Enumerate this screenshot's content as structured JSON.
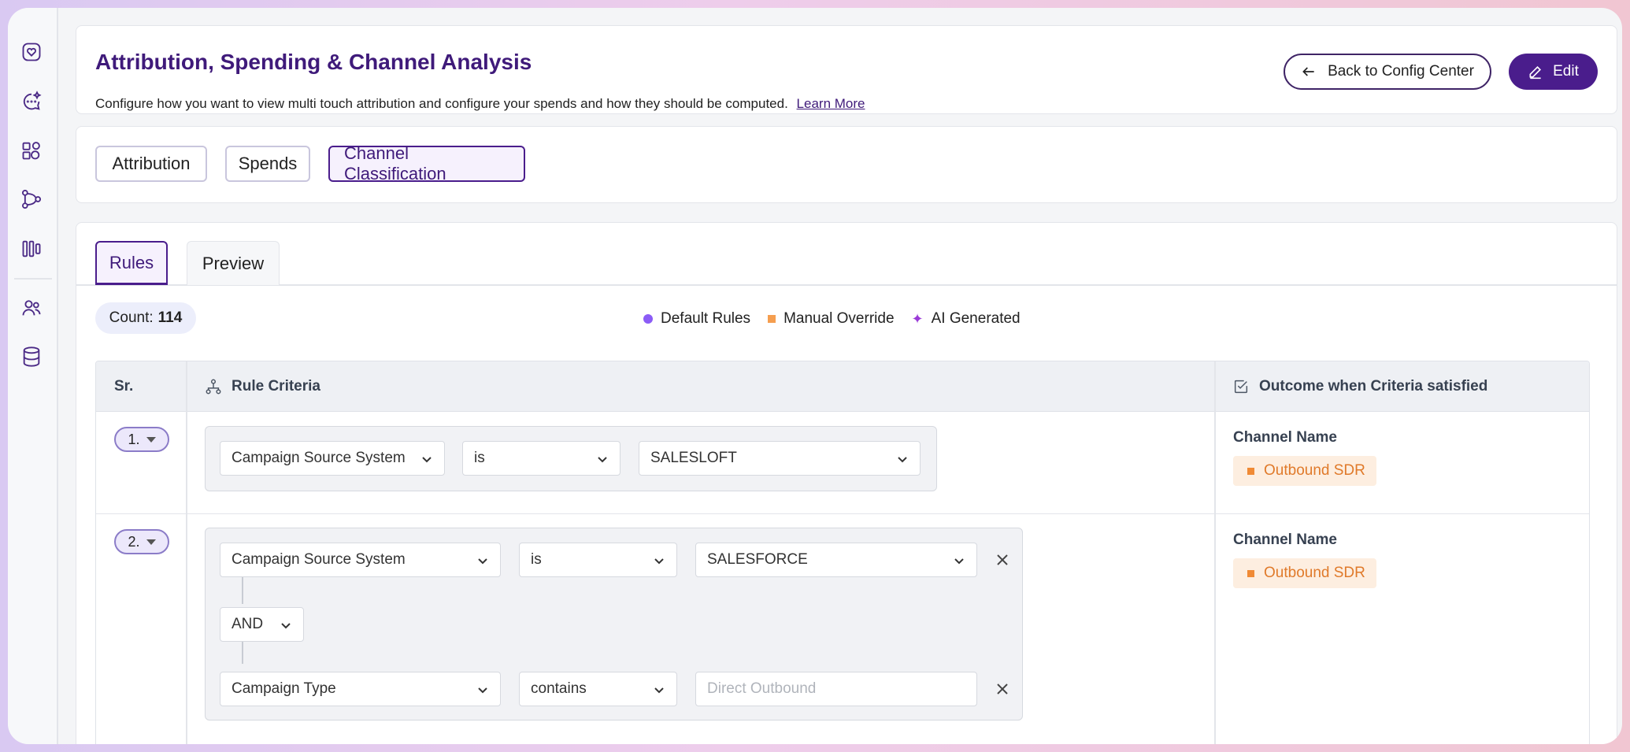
{
  "header": {
    "title": "Attribution, Spending & Channel Analysis",
    "subtitle": "Configure how you want to view multi touch attribution and configure your spends and how they should be computed.",
    "learn_more": "Learn More",
    "back_button": "Back to Config Center",
    "edit_button": "Edit"
  },
  "section_tabs": [
    "Attribution",
    "Spends",
    "Channel Classification"
  ],
  "active_section_tab": "Channel Classification",
  "sub_tabs": [
    "Rules",
    "Preview"
  ],
  "active_sub_tab": "Rules",
  "count": {
    "label": "Count:",
    "value": "114"
  },
  "legend": {
    "default": "Default Rules",
    "manual": "Manual Override",
    "ai": "AI Generated"
  },
  "table": {
    "col_sr": "Sr.",
    "col_criteria": "Rule Criteria",
    "col_outcome": "Outcome when Criteria satisfied",
    "rows": [
      {
        "sr": "1.",
        "field": "Campaign Source System",
        "operator": "is",
        "value": "SALESLOFT",
        "outcome_label": "Channel Name",
        "outcome_value": "Outbound SDR"
      },
      {
        "sr": "2.",
        "field": "Campaign Source System",
        "operator": "is",
        "value": "SALESFORCE",
        "join": "AND",
        "field2": "Campaign Type",
        "operator2": "contains",
        "value2_placeholder": "Direct Outbound",
        "outcome_label": "Channel Name",
        "outcome_value": "Outbound SDR"
      }
    ]
  },
  "colors": {
    "brand": "#4a1d8c",
    "default_rules": "#8b5cf6",
    "manual_override": "#f59e4f",
    "ai_generated": "#9b3bd8"
  }
}
